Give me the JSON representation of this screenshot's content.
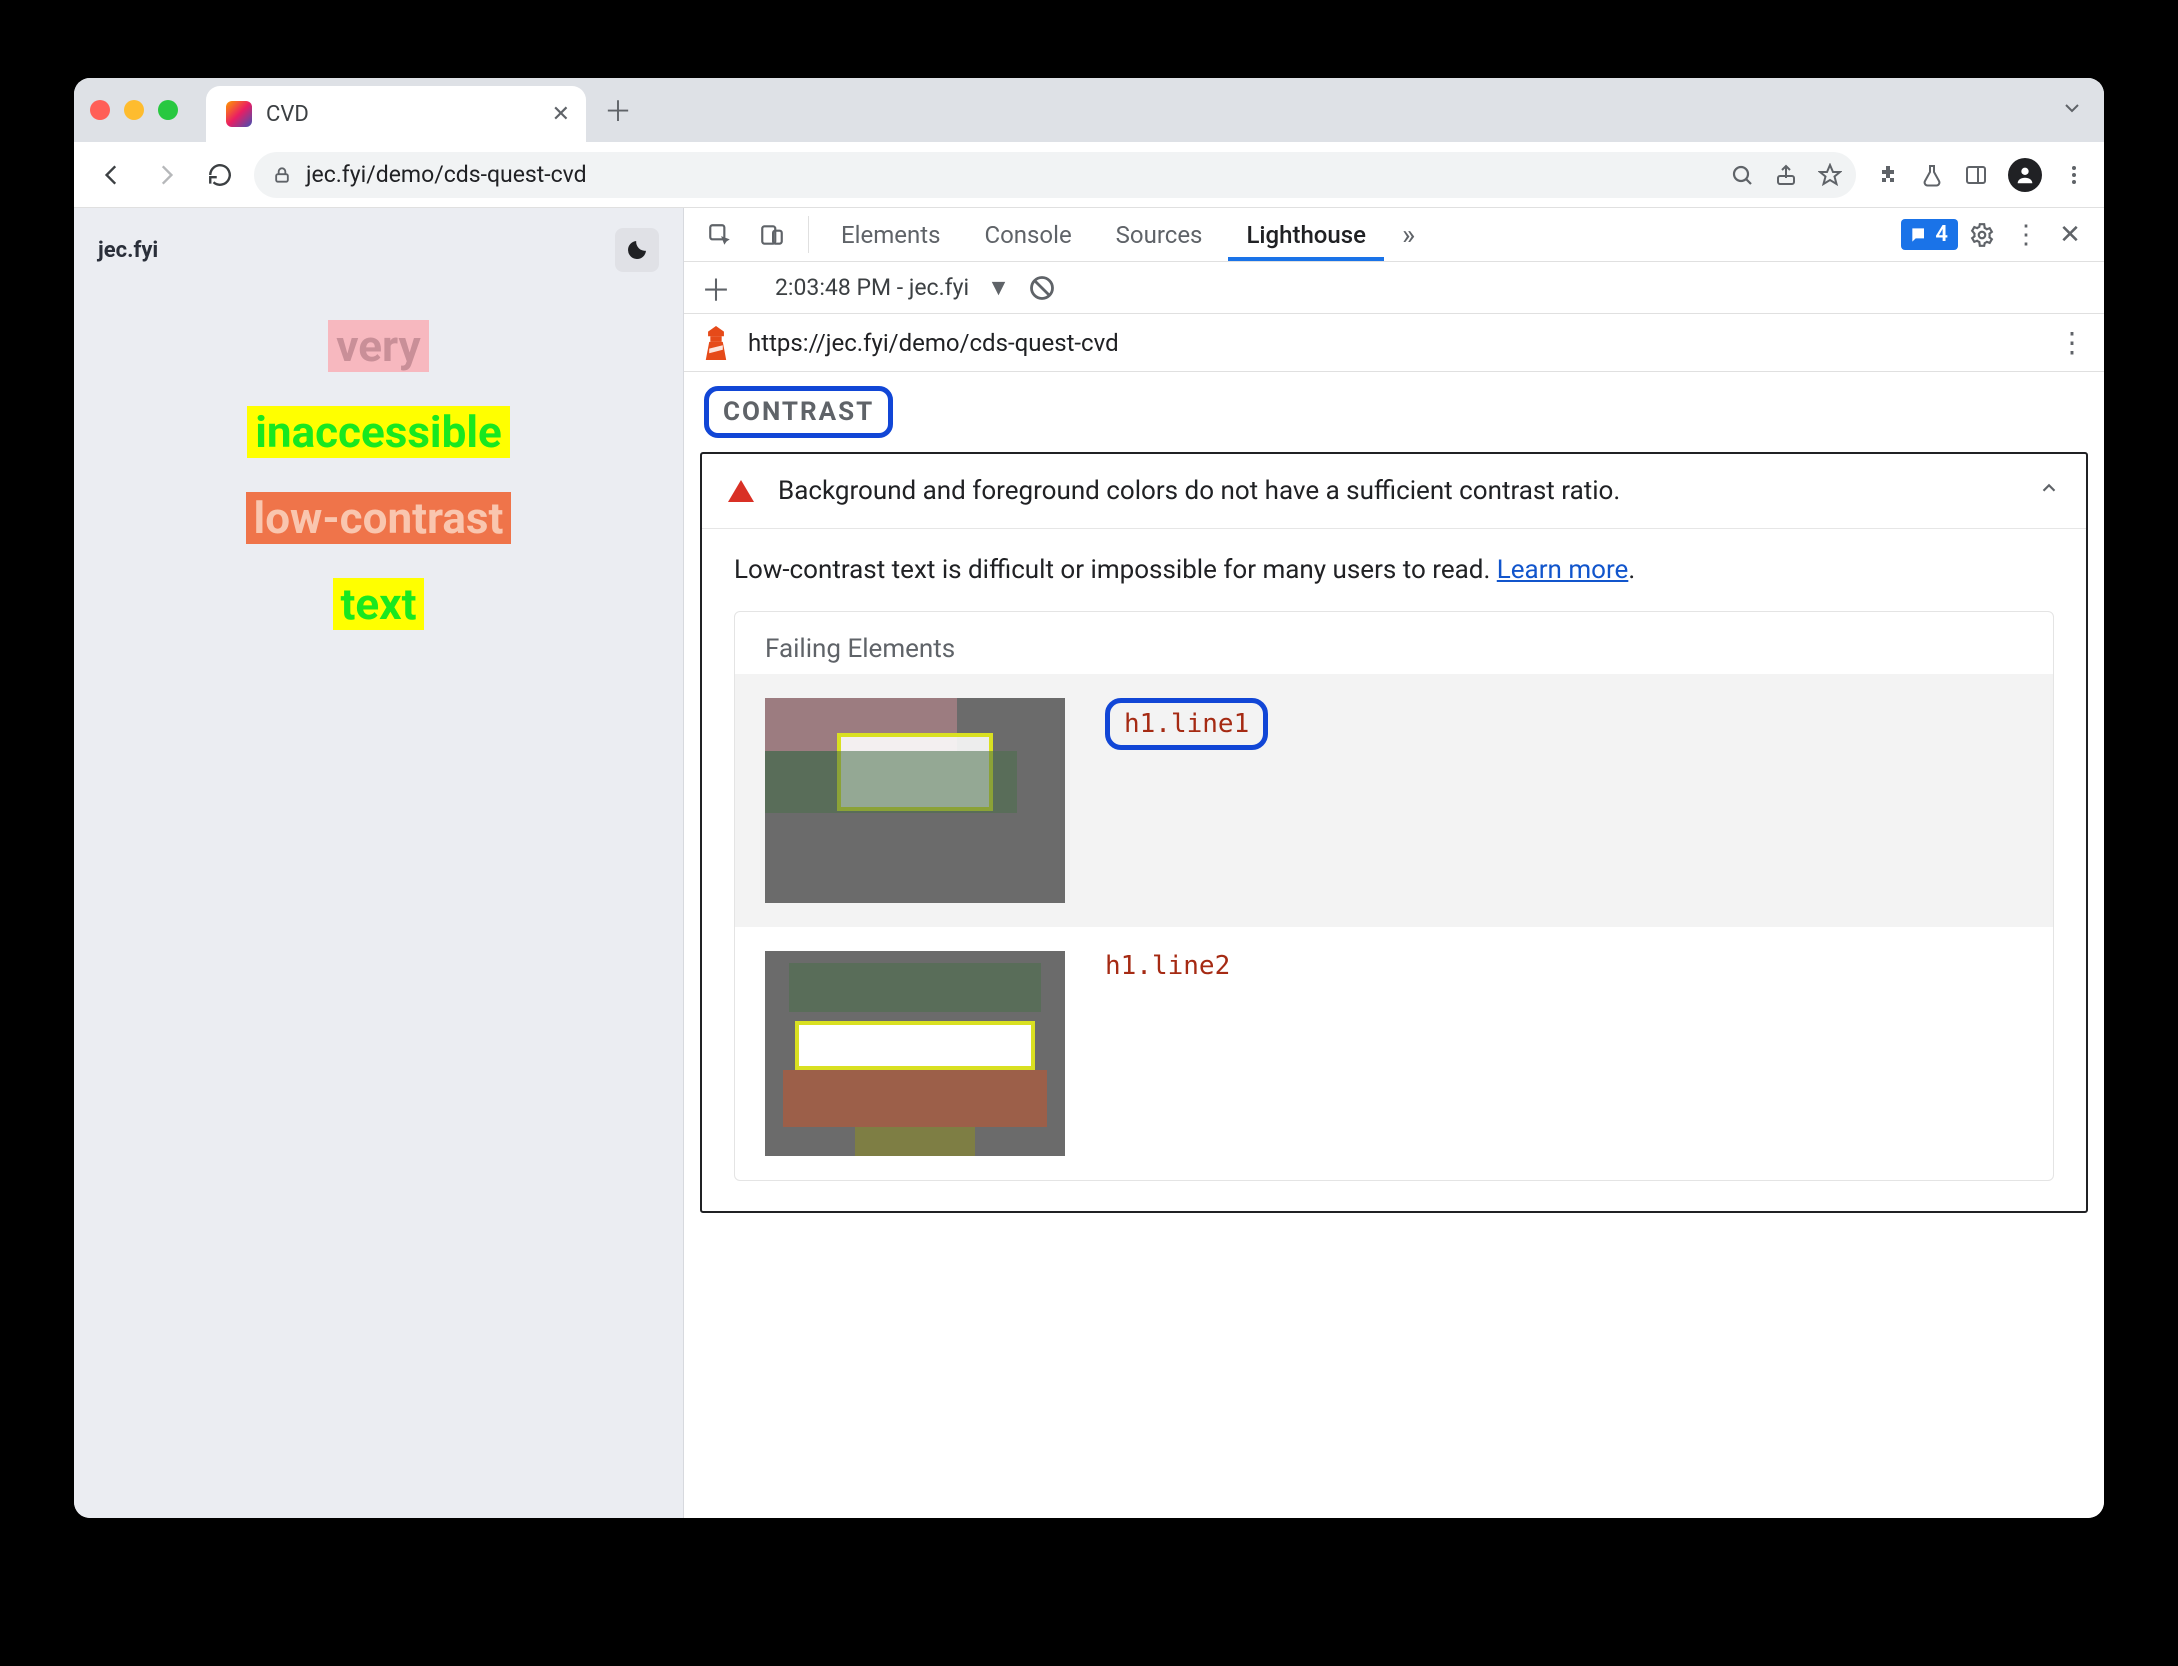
{
  "browser": {
    "tab_title": "CVD",
    "url_display": "jec.fyi/demo/cds-quest-cvd"
  },
  "page": {
    "site_name": "jec.fyi",
    "lines": {
      "l1": "very",
      "l2": "inaccessible",
      "l3": "low-contrast",
      "l4": "text"
    }
  },
  "devtools": {
    "tabs": {
      "elements": "Elements",
      "console": "Console",
      "sources": "Sources",
      "lighthouse": "Lighthouse"
    },
    "issues_count": "4",
    "report_select": "2:03:48 PM - jec.fyi",
    "report_url": "https://jec.fyi/demo/cds-quest-cvd",
    "section": "CONTRAST",
    "audit": {
      "title": "Background and foreground colors do not have a sufficient contrast ratio.",
      "desc": "Low-contrast text is difficult or impossible for many users to read. ",
      "learn_more": "Learn more",
      "failing_label": "Failing Elements",
      "rows": {
        "r1_selector": "h1.line1",
        "r2_selector": "h1.line2"
      }
    }
  }
}
